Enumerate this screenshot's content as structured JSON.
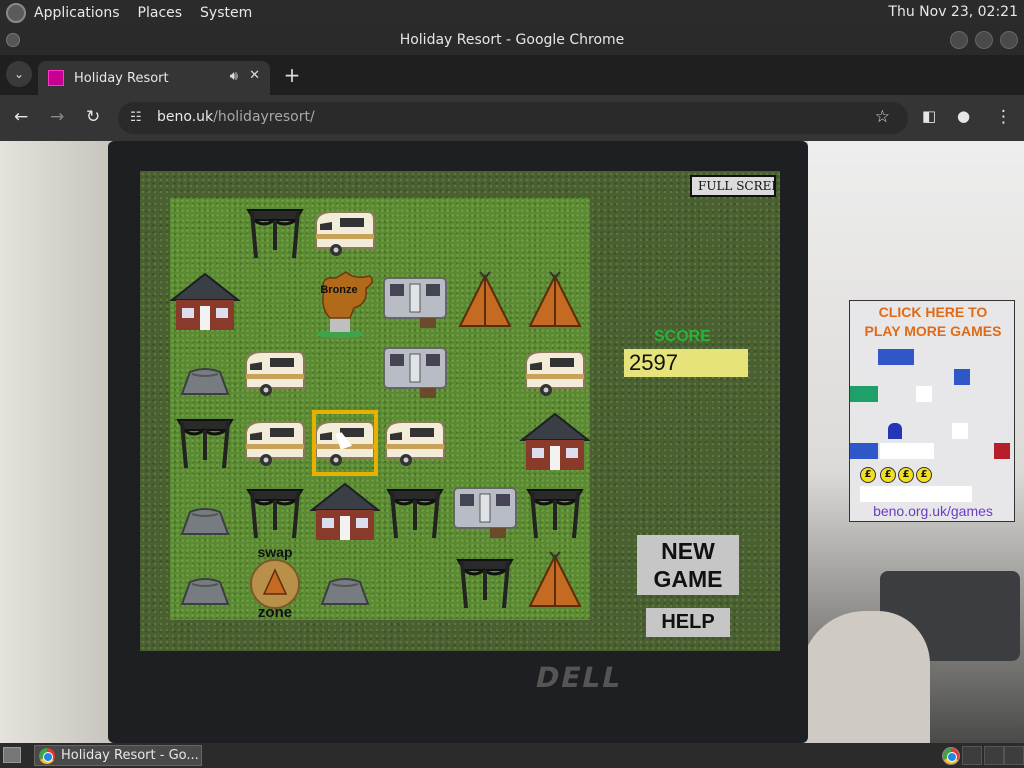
{
  "top_panel": {
    "menus": [
      "Applications",
      "Places",
      "System"
    ],
    "clock": "Thu Nov 23, 02:21"
  },
  "window": {
    "title": "Holiday Resort - Google Chrome"
  },
  "tab": {
    "title": "Holiday Resort"
  },
  "toolbar": {
    "url_domain": "beno.uk",
    "url_path": "/holidayresort/"
  },
  "game": {
    "fullscreen_label": "FULL SCREEN",
    "score_label": "SCORE",
    "score": "2597",
    "new_game_line1": "NEW",
    "new_game_line2": "GAME",
    "help_label": "HELP",
    "bronze_label": "Bronze",
    "swap_label": "swap",
    "zone_label": "zone",
    "grid": [
      [
        "empty",
        "gazebo",
        "caravan",
        "empty",
        "empty",
        "empty"
      ],
      [
        "house",
        "empty",
        "bronze-trophy",
        "static-caravan",
        "tent",
        "tent"
      ],
      [
        "rock",
        "caravan",
        "empty",
        "static-caravan",
        "empty",
        "caravan"
      ],
      [
        "gazebo",
        "caravan",
        "caravan-selected",
        "caravan",
        "empty",
        "house"
      ],
      [
        "rock",
        "gazebo",
        "house",
        "gazebo",
        "static-caravan",
        "gazebo"
      ],
      [
        "rock",
        "swap-zone",
        "rock",
        "empty",
        "gazebo",
        "tent"
      ]
    ]
  },
  "ad": {
    "title_line1": "CLICK HERE TO",
    "title_line2": "PLAY MORE GAMES",
    "link": "beno.org.uk/games",
    "coin_symbol": "£"
  },
  "taskbar": {
    "window_item": "Holiday Resort - Go..."
  }
}
